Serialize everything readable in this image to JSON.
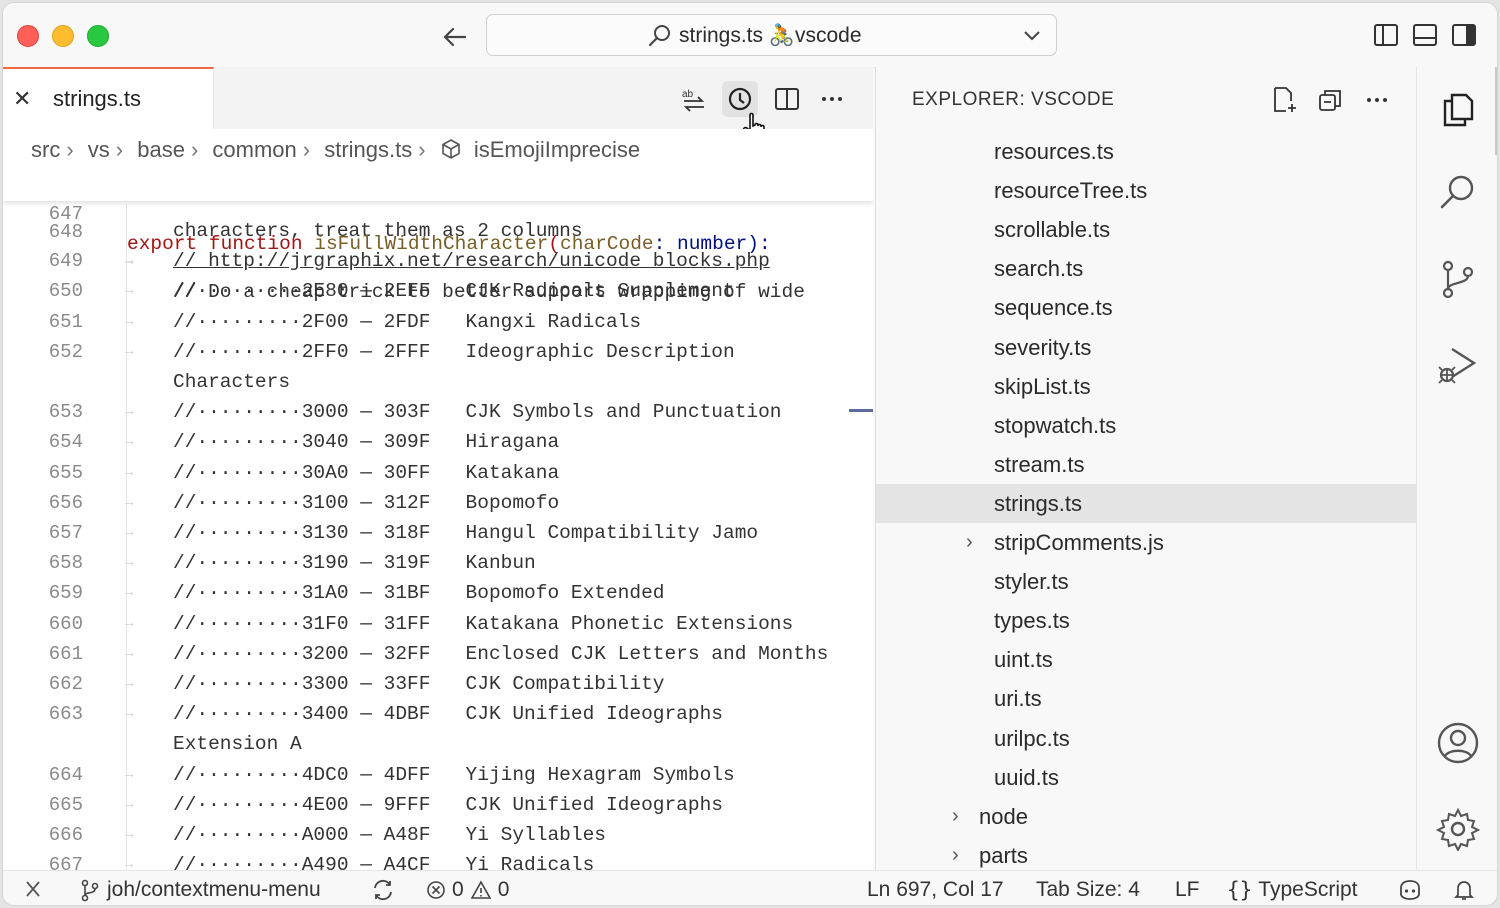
{
  "window": {
    "title": "strings.ts 🚴vscode"
  },
  "editor": {
    "tab_label": "strings.ts",
    "breadcrumb": [
      "src",
      "vs",
      "base",
      "common",
      "strings.ts",
      "isEmojiImprecise"
    ],
    "sticky": {
      "line_number": "647",
      "keyword1": "export",
      "keyword2": "function",
      "function_name": "isFullWidthCharacter",
      "open": "(",
      "param": "charCode",
      "colon": ": ",
      "type": "number",
      "close": "):"
    },
    "partial_line": {
      "line_number": "648",
      "text": "// Do a cheap trick to better support wrapping of wide"
    },
    "lines": [
      {
        "n": "",
        "text": "characters, treat them as 2 columns",
        "arrow": false
      },
      {
        "n": "649",
        "text": "// http://jrgraphix.net/research/unicode_blocks.php",
        "arrow": true,
        "link": true
      },
      {
        "n": "650",
        "text": "//·········2E80 — 2EFF   CJK Radicals Supplement",
        "arrow": true
      },
      {
        "n": "651",
        "text": "//·········2F00 — 2FDF   Kangxi Radicals",
        "arrow": true
      },
      {
        "n": "652",
        "text": "//·········2FF0 — 2FFF   Ideographic Description",
        "arrow": true
      },
      {
        "n": "",
        "text": "Characters",
        "arrow": false
      },
      {
        "n": "653",
        "text": "//·········3000 — 303F   CJK Symbols and Punctuation",
        "arrow": true
      },
      {
        "n": "654",
        "text": "//·········3040 — 309F   Hiragana",
        "arrow": true
      },
      {
        "n": "655",
        "text": "//·········30A0 — 30FF   Katakana",
        "arrow": true
      },
      {
        "n": "656",
        "text": "//·········3100 — 312F   Bopomofo",
        "arrow": true
      },
      {
        "n": "657",
        "text": "//·········3130 — 318F   Hangul Compatibility Jamo",
        "arrow": true
      },
      {
        "n": "658",
        "text": "//·········3190 — 319F   Kanbun",
        "arrow": true
      },
      {
        "n": "659",
        "text": "//·········31A0 — 31BF   Bopomofo Extended",
        "arrow": true
      },
      {
        "n": "660",
        "text": "//·········31F0 — 31FF   Katakana Phonetic Extensions",
        "arrow": true
      },
      {
        "n": "661",
        "text": "//·········3200 — 32FF   Enclosed CJK Letters and Months",
        "arrow": true
      },
      {
        "n": "662",
        "text": "//·········3300 — 33FF   CJK Compatibility",
        "arrow": true
      },
      {
        "n": "663",
        "text": "//·········3400 — 4DBF   CJK Unified Ideographs",
        "arrow": true
      },
      {
        "n": "",
        "text": "Extension A",
        "arrow": false
      },
      {
        "n": "664",
        "text": "//·········4DC0 — 4DFF   Yijing Hexagram Symbols",
        "arrow": true
      },
      {
        "n": "665",
        "text": "//·········4E00 — 9FFF   CJK Unified Ideographs",
        "arrow": true
      },
      {
        "n": "666",
        "text": "//·········A000 — A48F   Yi Syllables",
        "arrow": true
      },
      {
        "n": "667",
        "text": "//·········A490 — A4CF   Yi Radicals",
        "arrow": true
      }
    ]
  },
  "explorer": {
    "title": "EXPLORER: VSCODE",
    "items": [
      {
        "label": "resources.ts",
        "kind": "file"
      },
      {
        "label": "resourceTree.ts",
        "kind": "file"
      },
      {
        "label": "scrollable.ts",
        "kind": "file"
      },
      {
        "label": "search.ts",
        "kind": "file"
      },
      {
        "label": "sequence.ts",
        "kind": "file"
      },
      {
        "label": "severity.ts",
        "kind": "file"
      },
      {
        "label": "skipList.ts",
        "kind": "file"
      },
      {
        "label": "stopwatch.ts",
        "kind": "file"
      },
      {
        "label": "stream.ts",
        "kind": "file"
      },
      {
        "label": "strings.ts",
        "kind": "file",
        "selected": true
      },
      {
        "label": "stripComments.js",
        "kind": "collapsed-file"
      },
      {
        "label": "styler.ts",
        "kind": "file"
      },
      {
        "label": "types.ts",
        "kind": "file"
      },
      {
        "label": "uint.ts",
        "kind": "file"
      },
      {
        "label": "uri.ts",
        "kind": "file"
      },
      {
        "label": "urilpc.ts",
        "kind": "file"
      },
      {
        "label": "uuid.ts",
        "kind": "file"
      },
      {
        "label": "node",
        "kind": "folder"
      },
      {
        "label": "parts",
        "kind": "folder"
      }
    ]
  },
  "statusbar": {
    "branch": "joh/contextmenu-menu",
    "errors": "0",
    "warnings": "0",
    "position": "Ln 697, Col 17",
    "tab_size": "Tab Size: 4",
    "eol": "LF",
    "language": "TypeScript"
  },
  "colors": {
    "tab_accent": "#f06940",
    "keyword": "#a31515",
    "function": "#795e26",
    "param": "#001080",
    "type": "#267f99"
  }
}
